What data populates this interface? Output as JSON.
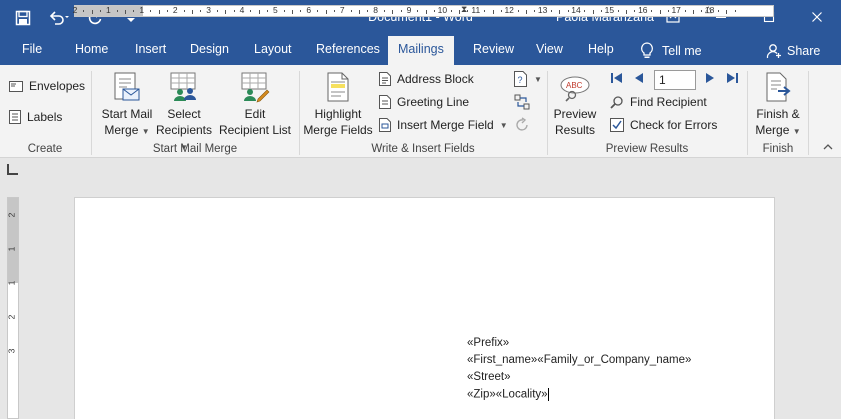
{
  "titlebar": {
    "document_title": "Document1  -  Word",
    "user_name": "Paola Maranzana",
    "bg_color": "#2b579a"
  },
  "quick_access": [
    "save-icon",
    "undo-icon",
    "redo-icon",
    "customize-icon"
  ],
  "tabs": {
    "file": "File",
    "home": "Home",
    "insert": "Insert",
    "design": "Design",
    "layout": "Layout",
    "references": "References",
    "mailings": "Mailings",
    "review": "Review",
    "view": "View",
    "help": "Help",
    "tell_me": "Tell me",
    "share": "Share",
    "active": "Mailings"
  },
  "ribbon": {
    "create": {
      "label": "Create",
      "envelopes": "Envelopes",
      "labels": "Labels"
    },
    "start_mail_merge": {
      "label": "Start Mail Merge",
      "start_line1": "Start Mail",
      "start_line2": "Merge",
      "select_line1": "Select",
      "select_line2": "Recipients",
      "edit_line1": "Edit",
      "edit_line2": "Recipient List"
    },
    "write_insert": {
      "label": "Write & Insert Fields",
      "highlight_line1": "Highlight",
      "highlight_line2": "Merge Fields",
      "address_block": "Address Block",
      "greeting_line": "Greeting Line",
      "insert_merge_field": "Insert Merge Field"
    },
    "preview": {
      "label": "Preview Results",
      "preview_line1": "Preview",
      "preview_line2": "Results",
      "record_number": "1",
      "find_recipient": "Find Recipient",
      "check_errors": "Check for Errors"
    },
    "finish": {
      "label": "Finish",
      "finish_line1": "Finish &",
      "finish_line2": "Merge"
    }
  },
  "ruler": {
    "numbers": [
      "2",
      "1",
      "1",
      "2",
      "3",
      "4",
      "5",
      "6",
      "7",
      "8",
      "9",
      "10",
      "11",
      "12",
      "13",
      "14",
      "15",
      "16",
      "17",
      "18"
    ],
    "vertical_numbers": [
      "2",
      "1",
      "1",
      "2",
      "3"
    ]
  },
  "document": {
    "lines": [
      "«Prefix»",
      "«First_name»«Family_or_Company_name»",
      "«Street»",
      "«Zip»«Locality»"
    ]
  }
}
